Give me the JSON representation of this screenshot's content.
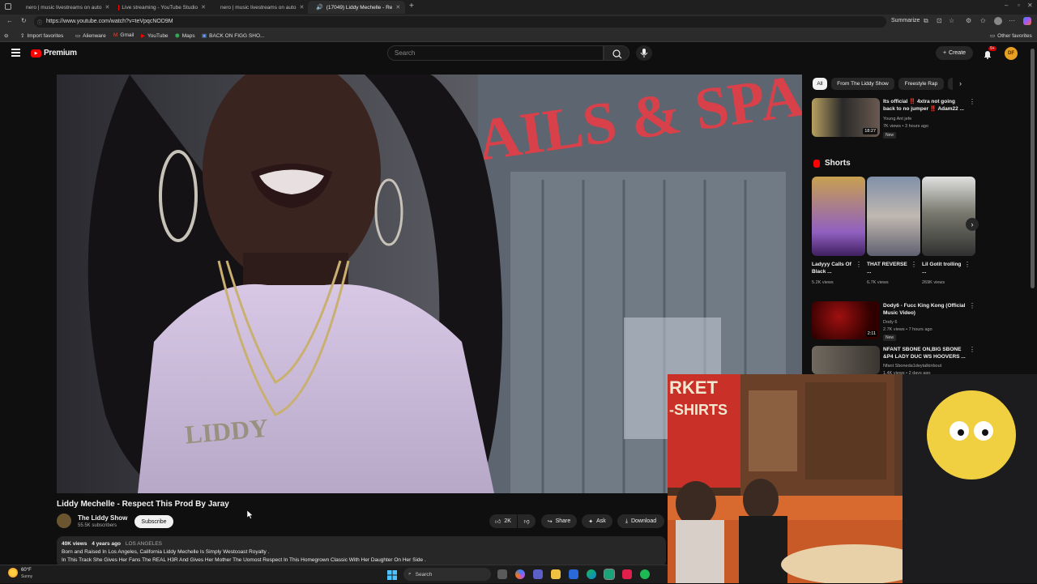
{
  "browser": {
    "tabs": [
      {
        "title": "nero | music livestreams on auto",
        "color": "#3c4043"
      },
      {
        "title": "Live streaming - YouTube Studio",
        "color": "#ff0000"
      },
      {
        "title": "nero | music livestreams on auto",
        "color": "#3c4043"
      },
      {
        "title": "(17049) Liddy Mechelle - Re",
        "color": "#ff0000"
      }
    ],
    "url": "https://www.youtube.com/watch?v=teVpqcNOD9M",
    "summarize_label": "Summarize",
    "bookmarks": [
      "Import favorites",
      "Alienware",
      "Gmail",
      "YouTube",
      "Maps",
      "BACK ON FIGG SHO..."
    ],
    "other_favorites": "Other favorites"
  },
  "youtube": {
    "logo_text": "Premium",
    "search_placeholder": "Search",
    "create_label": "Create",
    "notification_count": "9+",
    "avatar_initials": "DF"
  },
  "video": {
    "title": "Liddy Mechelle - Respect This Prod By Jaray",
    "necklace_text": "LIDDY",
    "storefront_text": "AILS & SPA",
    "channel": "The Liddy Show",
    "subscribers": "55.5K subscribers",
    "subscribe_label": "Subscribe",
    "likes": "2K",
    "share_label": "Share",
    "ask_label": "Ask",
    "download_label": "Download",
    "views": "40K views",
    "age": "4 years ago",
    "location": "LOS ANGELES",
    "description_line1": "Born and Raised In Los Angeles, California Liddy Mechelle Is Simply Westcoast Royalty .",
    "description_line2": "In This Track She Gives Her Fans The REAL H3R And Gives Her Mother The Uomost Respect In This Homegrown Classic With Her Daughter On Her Side ."
  },
  "sidebar": {
    "chips": [
      "All",
      "From The Liddy Show",
      "Freestyle Rap"
    ],
    "top_video": {
      "title": "Its official ‼️ 4xtra not going back to no jumper ‼️ Adam22 ...",
      "channel": "Young Ant jefe",
      "meta": "7K views • 3 hours ago",
      "badge": "New",
      "duration": "18:27"
    },
    "shorts_heading": "Shorts",
    "shorts": [
      {
        "title": "Ladyyy Calls Of Black ...",
        "views": "5.2K views"
      },
      {
        "title": "THAT REVERSE ...",
        "views": "6.7K views"
      },
      {
        "title": "Lil Gotit trolling ...",
        "views": "269K views"
      }
    ],
    "videos": [
      {
        "title": "Dody6 - Fucc King Kong (Official Music Video)",
        "channel": "Dody 6",
        "meta": "2.7K views • 7 hours ago",
        "badge": "New",
        "duration": "2:11"
      },
      {
        "title": "NFANT SBONE ON,BIG SBONE &P4 LADY DUC WS HOOVERS ...",
        "channel": "Nfant Sboneda1deytalkinbout",
        "meta": "1.4K views • 2 days ago"
      }
    ]
  },
  "overlay": {
    "sign_text": "RKET",
    "sign_sub": "-SHIRTS"
  },
  "taskbar": {
    "weather_temp": "60°F",
    "weather_desc": "Sunny",
    "search_label": "Search"
  },
  "colors": {
    "youtube_red": "#ff0000",
    "background": "#0f0f0f",
    "chip_bg": "#272727"
  }
}
